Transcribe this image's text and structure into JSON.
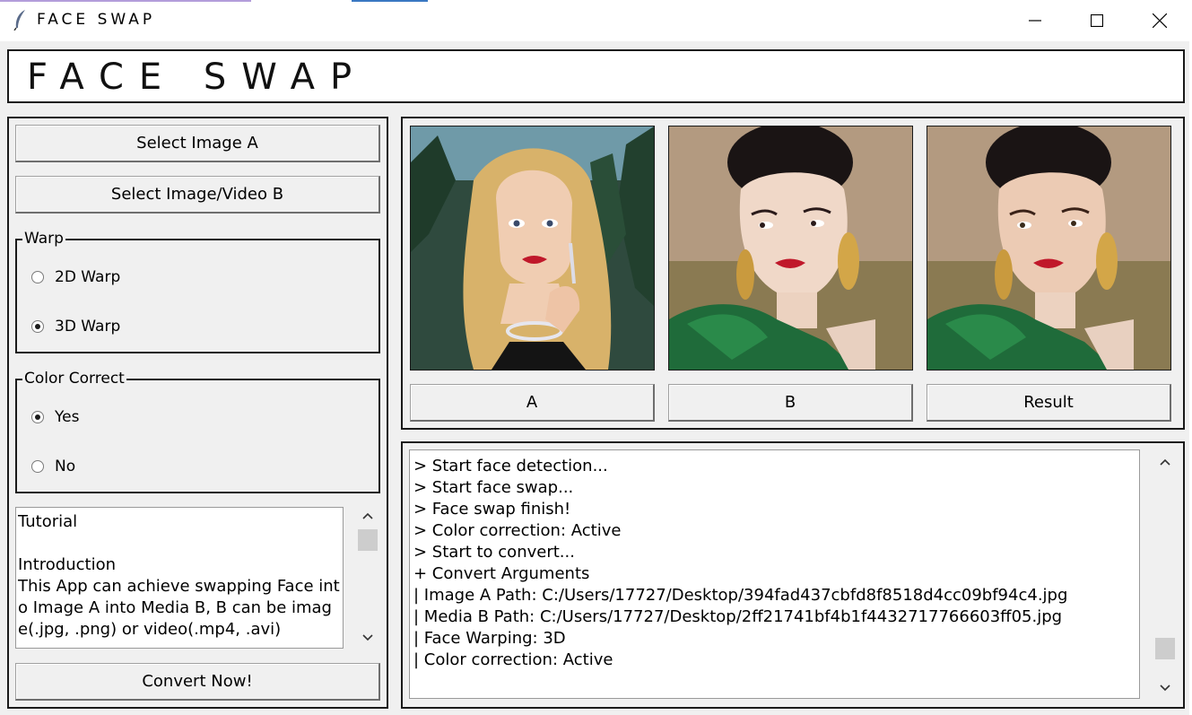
{
  "window": {
    "title": "FACE SWAP",
    "icon": "feather-icon",
    "controls": [
      "minimize-icon",
      "maximize-icon",
      "close-icon"
    ]
  },
  "header": {
    "heading": "FACE SWAP"
  },
  "left_panel": {
    "select_a_label": "Select Image A",
    "select_b_label": "Select Image/Video B",
    "warp_group": {
      "legend": "Warp",
      "options": [
        {
          "label": "2D Warp",
          "checked": false
        },
        {
          "label": "3D Warp",
          "checked": true
        }
      ]
    },
    "color_group": {
      "legend": "Color Correct",
      "options": [
        {
          "label": "Yes",
          "checked": true
        },
        {
          "label": "No",
          "checked": false
        }
      ]
    },
    "tutorial_text": "Tutorial\n\nIntroduction\nThis App can achieve swapping Face into Image A into Media B, B can be image(.jpg, .png) or video(.mp4, .avi)",
    "convert_label": "Convert Now!"
  },
  "images": {
    "buttons": [
      "A",
      "B",
      "Result"
    ],
    "previews": [
      "image-a-preview",
      "image-b-preview",
      "result-preview"
    ],
    "colors": {
      "blonde_hair": "#d8b26a",
      "green_dress": "#1f6b3a",
      "field_bg": "#a08868",
      "lips": "#c0182a"
    }
  },
  "log": {
    "lines": [
      "> Start face detection...",
      "> Start face swap...",
      "> Face swap finish!",
      "> Color correction: Active",
      "> Start to convert...",
      "+ Convert Arguments",
      "| Image A Path: C:/Users/17727/Desktop/394fad437cbfd8f8518d4cc09bf94c4.jpg",
      "| Media B Path: C:/Users/17727/Desktop/2ff21741bf4b1f4432717766603ff05.jpg",
      "| Face Warping: 3D",
      "| Color correction: Active"
    ]
  }
}
